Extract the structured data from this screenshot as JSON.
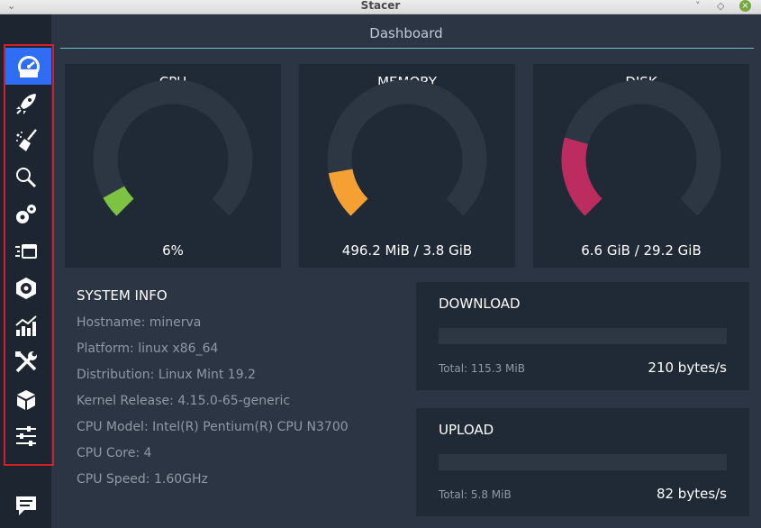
{
  "window": {
    "title": "Stacer"
  },
  "sidebar": {
    "items": [
      {
        "icon": "speedometer-icon",
        "label": "Dashboard",
        "active": true
      },
      {
        "icon": "rocket-icon",
        "label": "Startup Apps"
      },
      {
        "icon": "broom-icon",
        "label": "System Cleaner"
      },
      {
        "icon": "magnifier-icon",
        "label": "Search"
      },
      {
        "icon": "gears-icon",
        "label": "Services"
      },
      {
        "icon": "processes-icon",
        "label": "Processes"
      },
      {
        "icon": "package-uninstaller-icon",
        "label": "Uninstaller"
      },
      {
        "icon": "resources-chart-icon",
        "label": "Resources"
      },
      {
        "icon": "tools-icon",
        "label": "Helpers"
      },
      {
        "icon": "box-icon",
        "label": "APT Repository Manager"
      },
      {
        "icon": "sliders-icon",
        "label": "Settings"
      }
    ],
    "feedback_icon": "feedback-message-icon"
  },
  "main": {
    "title": "Dashboard",
    "accent_color": "#67c3cb",
    "gauges": [
      {
        "title": "CPU",
        "value": "6%",
        "percent": 6,
        "color": "#7dc242"
      },
      {
        "title": "MEMORY",
        "value": "496.2 MiB / 3.8 GiB",
        "percent": 13,
        "color": "#f5a033"
      },
      {
        "title": "DISK",
        "value": "6.6 GiB / 29.2 GiB",
        "percent": 22.6,
        "color": "#bd2c5e"
      }
    ],
    "system_info": {
      "title": "SYSTEM INFO",
      "rows": [
        "Hostname: minerva",
        "Platform: linux x86_64",
        "Distribution: Linux Mint 19.2",
        "Kernel Release: 4.15.0-65-generic",
        "CPU Model: Intel(R) Pentium(R) CPU N3700",
        "CPU Core: 4",
        "CPU Speed: 1.60GHz"
      ]
    },
    "download": {
      "title": "DOWNLOAD",
      "total": "Total: 115.3 MiB",
      "rate": "210 bytes/s"
    },
    "upload": {
      "title": "UPLOAD",
      "total": "Total: 5.8 MiB",
      "rate": "82 bytes/s"
    }
  }
}
